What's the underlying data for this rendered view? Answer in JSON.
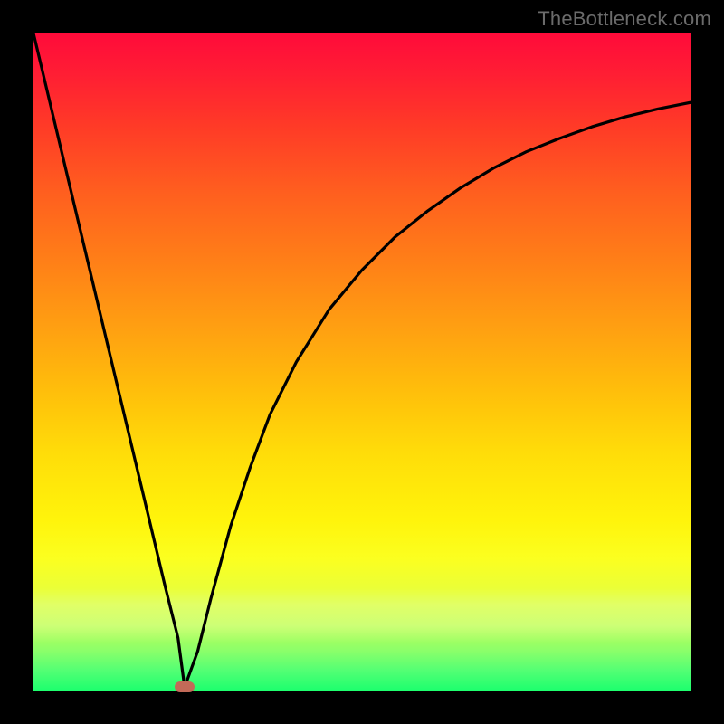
{
  "watermark": "TheBottleneck.com",
  "chart_data": {
    "type": "line",
    "title": "",
    "xlabel": "",
    "ylabel": "",
    "xlim": [
      0,
      100
    ],
    "ylim": [
      0,
      100
    ],
    "legend": false,
    "grid": false,
    "series": [
      {
        "name": "bottleneck-curve",
        "x": [
          0,
          5,
          10,
          15,
          17.5,
          20,
          22,
          23,
          25,
          27,
          30,
          33,
          36,
          40,
          45,
          50,
          55,
          60,
          65,
          70,
          75,
          80,
          85,
          90,
          95,
          100
        ],
        "values": [
          100,
          79,
          58,
          37,
          26.5,
          16,
          8,
          0.5,
          6,
          14,
          25,
          34,
          42,
          50,
          58,
          64,
          69,
          73,
          76.5,
          79.5,
          82,
          84,
          85.8,
          87.3,
          88.5,
          89.5
        ]
      }
    ],
    "annotations": [
      {
        "name": "optimum",
        "x": 23,
        "y": 0.5
      }
    ],
    "background": "rainbow-vertical",
    "colors": {
      "curve": "#000000",
      "marker": "#c26a58",
      "top": "#ff0b3a",
      "bottom": "#1dff6e"
    }
  }
}
